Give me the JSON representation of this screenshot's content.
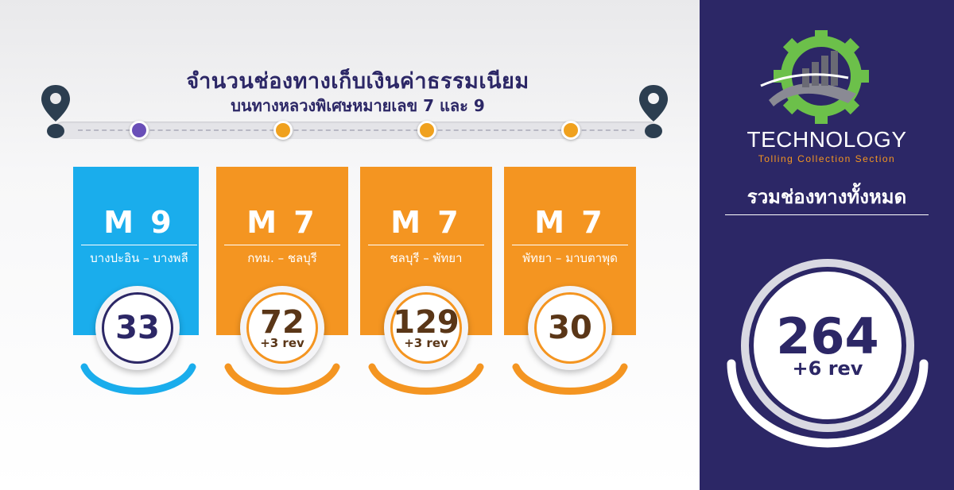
{
  "title": {
    "line1": "จำนวนช่องทางเก็บเงินค่าธรรมเนียม",
    "line2": "บนทางหลวงพิเศษหมายเลข 7 และ 9"
  },
  "colors": {
    "navy": "#2c2766",
    "blue": "#1aadec",
    "orange": "#f49521",
    "purple": "#6a4fb8",
    "brown": "#5a3617"
  },
  "timeline": {
    "start_icon": "location-pin-icon",
    "end_icon": "location-pin-icon",
    "dots": [
      "purple",
      "orange",
      "orange",
      "orange"
    ]
  },
  "cards": [
    {
      "road": "M 9",
      "segment": "บางปะอิน – บางพลี",
      "lanes": "33",
      "rev": ""
    },
    {
      "road": "M 7",
      "segment": "กทม. – ชลบุรี",
      "lanes": "72",
      "rev": "+3 rev"
    },
    {
      "road": "M 7",
      "segment": "ชลบุรี – พัทยา",
      "lanes": "129",
      "rev": "+3 rev"
    },
    {
      "road": "M 7",
      "segment": "พัทยา – มาบตาพุด",
      "lanes": "30",
      "rev": ""
    }
  ],
  "brand": {
    "logo_icon": "gear-chart-icon",
    "name": "TECHNOLOGY",
    "subtitle": "Tolling Collection Section"
  },
  "total": {
    "label": "รวมช่องทางทั้งหมด",
    "lanes": "264",
    "rev": "+6 rev"
  }
}
